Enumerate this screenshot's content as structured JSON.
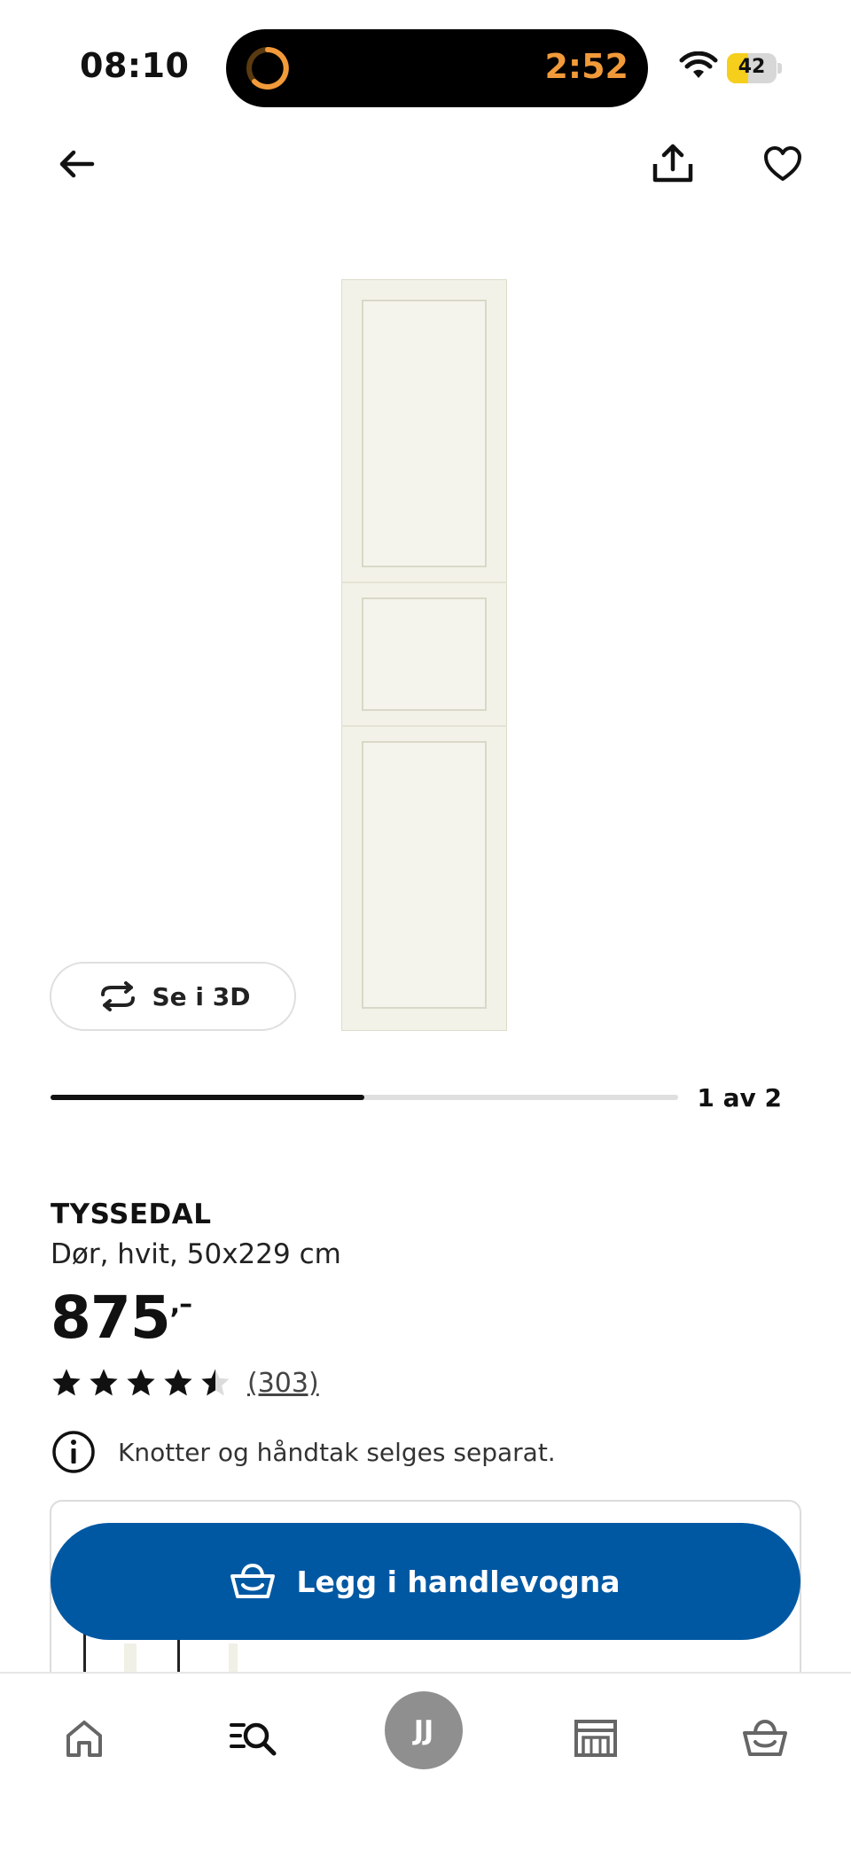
{
  "status_bar": {
    "time": "08:10",
    "island_timer": "2:52",
    "battery_level": "42",
    "battery_fraction": 0.42,
    "accent_color": "#f29a3a"
  },
  "top_nav": {
    "icons": [
      "arrow-left-icon",
      "share-icon",
      "heart-icon"
    ]
  },
  "gallery": {
    "view_3d_label": "Se i 3D",
    "counter": "1 av 2",
    "progress_fraction": 0.5
  },
  "product": {
    "name": "TYSSEDAL",
    "description": "Dør, hvit, 50x229 cm",
    "price": "875",
    "price_suffix": ",–",
    "rating": 4.5,
    "review_count": "(303)",
    "notice": "Knotter og håndtak selges separat."
  },
  "cta": {
    "label": "Legg i handlevogna",
    "color": "#0058a3"
  },
  "tab_bar": {
    "avatar_initials": "JJ",
    "tabs": [
      "home-icon",
      "search-list-icon",
      "profile-avatar",
      "store-icon",
      "basket-icon"
    ]
  }
}
